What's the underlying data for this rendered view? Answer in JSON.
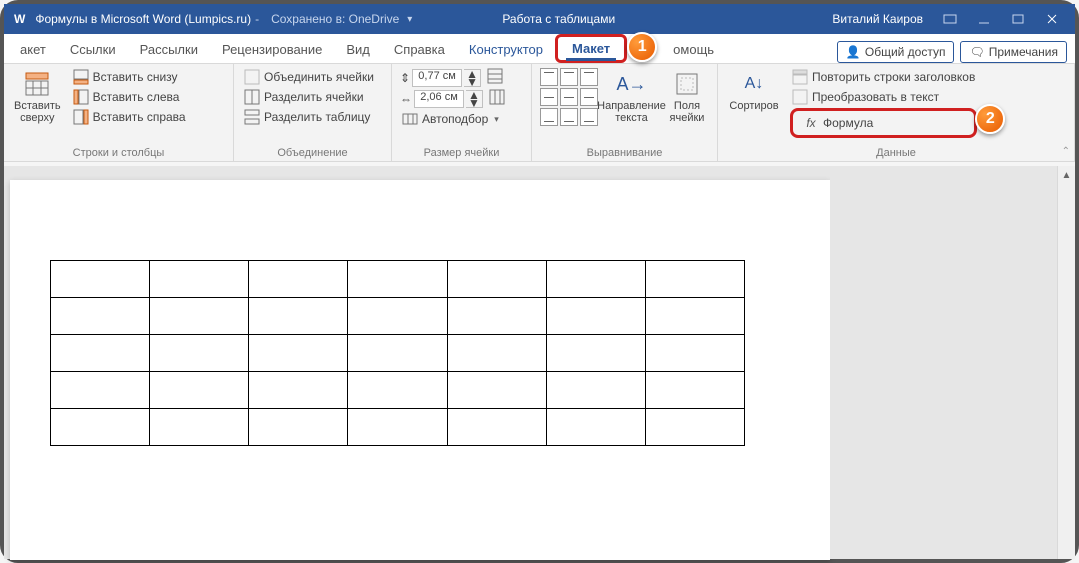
{
  "title": "Формулы в Microsoft Word (Lumpics.ru)",
  "saved_label": "Сохранено в: OneDrive",
  "contextual_title": "Работа с таблицами",
  "user": "Виталий Каиров",
  "tabs": {
    "maket_partial": "акет",
    "links": "Ссылки",
    "mailings": "Рассылки",
    "review": "Рецензирование",
    "view": "Вид",
    "help": "Справка",
    "constructor": "Конструктор",
    "layout": "Макет",
    "help_partial": "омощь"
  },
  "share": {
    "share_label": "Общий доступ",
    "comments_label": "Примечания"
  },
  "ribbon": {
    "rows_cols": {
      "insert_above": "Вставить\nсверху",
      "insert_below": "Вставить снизу",
      "insert_left": "Вставить слева",
      "insert_right": "Вставить справа",
      "group": "Строки и столбцы"
    },
    "merge": {
      "merge_cells": "Объединить ячейки",
      "split_cells": "Разделить ячейки",
      "split_table": "Разделить таблицу",
      "group": "Объединение"
    },
    "cellsize": {
      "height_icon": "↕",
      "height": "0,77 см",
      "width_icon": "↔",
      "width": "2,06 см",
      "autofit": "Автоподбор",
      "group": "Размер ячейки"
    },
    "align": {
      "text_dir": "Направление\nтекста",
      "margins": "Поля\nячейки",
      "group": "Выравнивание"
    },
    "data": {
      "sort": "Сортиров",
      "repeat_header": "Повторить строки заголовков",
      "convert": "Преобразовать в текст",
      "formula": "Формула",
      "group": "Данные"
    }
  },
  "badges": {
    "one": "1",
    "two": "2"
  },
  "table": {
    "rows": 5,
    "cols": 7
  }
}
